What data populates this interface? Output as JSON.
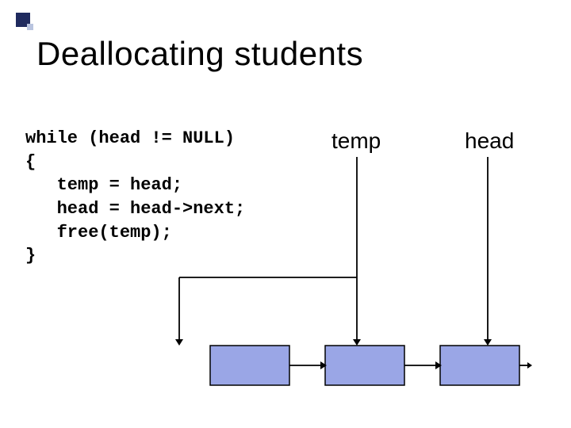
{
  "title": "Deallocating students",
  "code": {
    "l1": "while (head != NULL)",
    "l2": "{",
    "l3": "   temp = head;",
    "l4": "   head = head->next;",
    "l5": "   free(temp);",
    "l6": "}"
  },
  "labels": {
    "temp": "temp",
    "head": "head"
  },
  "chart_data": {
    "type": "diagram",
    "description": "Linked list traversal during deallocation",
    "pointers": [
      {
        "name": "temp",
        "points_to_node_index": 1
      },
      {
        "name": "head",
        "points_to_node_index": 2
      }
    ],
    "nodes": [
      {
        "index": 0,
        "freed": true
      },
      {
        "index": 1,
        "freed": false
      },
      {
        "index": 2,
        "freed": false
      }
    ],
    "extra_arrow": {
      "from": "left_of_diagram",
      "to_node_index": 0,
      "meaning": "previous_step_reference"
    }
  }
}
